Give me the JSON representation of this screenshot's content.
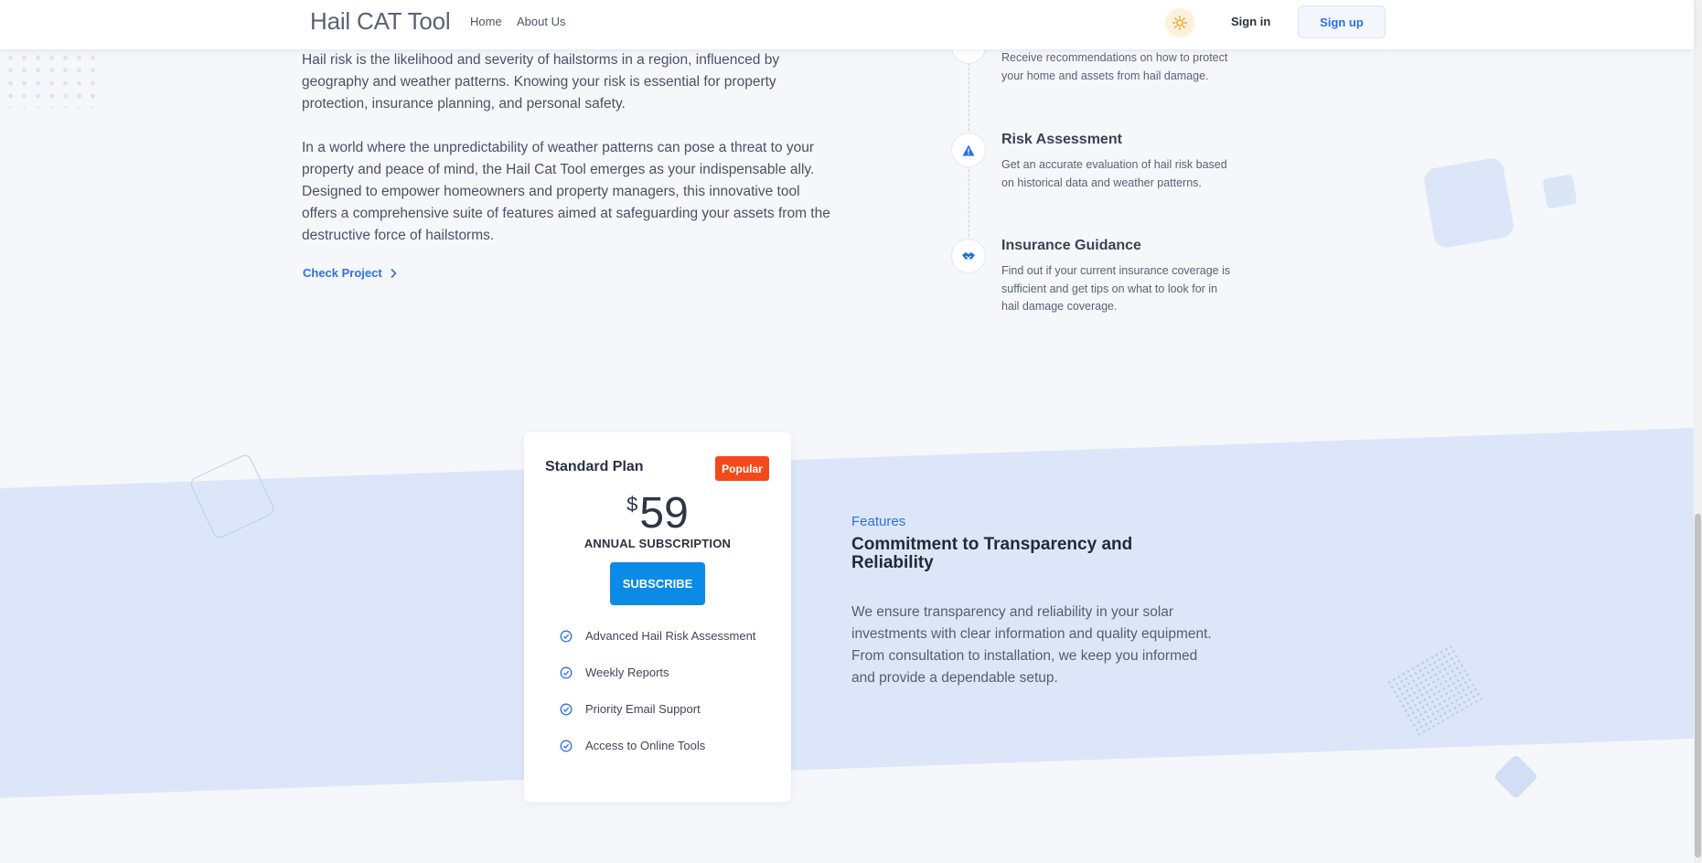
{
  "nav": {
    "brand": "Hail CAT Tool",
    "links": [
      "Home",
      "About Us"
    ],
    "theme_icon": "sun-icon",
    "sign_in": "Sign in",
    "sign_up": "Sign up"
  },
  "intro": {
    "paragraph1": "Hail risk is the likelihood and severity of hailstorms in a region, influenced by geography and weather patterns. Knowing your risk is essential for property protection, insurance planning, and personal safety.",
    "paragraph2": "In a world where the unpredictability of weather patterns can pose a threat to your property and peace of mind, the Hail Cat Tool emerges as your indispensable ally. Designed to empower homeowners and property managers, this innovative tool offers a comprehensive suite of features aimed at safeguarding your assets from the destructive force of hailstorms.",
    "link": "Check Project"
  },
  "timeline": {
    "items": [
      {
        "title": "",
        "desc": "Receive recommendations on how to protect your home and assets from hail damage.",
        "icon": "shield-icon"
      },
      {
        "title": "Risk Assessment",
        "desc": "Get an accurate evaluation of hail risk based on historical data and weather patterns.",
        "icon": "warning-icon"
      },
      {
        "title": "Insurance Guidance",
        "desc": "Find out if your current insurance coverage is sufficient and get tips on what to look for in hail damage coverage.",
        "icon": "handshake-icon"
      }
    ]
  },
  "pricing": {
    "plan": "Standard Plan",
    "badge": "Popular",
    "currency": "$",
    "price": "59",
    "period": "ANNUAL SUBSCRIPTION",
    "cta": "SUBSCRIBE",
    "features": [
      "Advanced Hail Risk Assessment",
      "Weekly Reports",
      "Priority Email Support",
      "Access to Online Tools"
    ]
  },
  "features_section": {
    "eyebrow": "Features",
    "title": "Commitment to Transparency and Reliability",
    "desc": "We ensure transparency and reliability in your solar investments with clear information and quality equipment. From consultation to installation, we keep you informed and provide a dependable setup."
  },
  "colors": {
    "accent": "#2f6fe4",
    "subscribe": "#0b8be6",
    "badge": "#f24a1d",
    "band": "#dde6f8"
  }
}
